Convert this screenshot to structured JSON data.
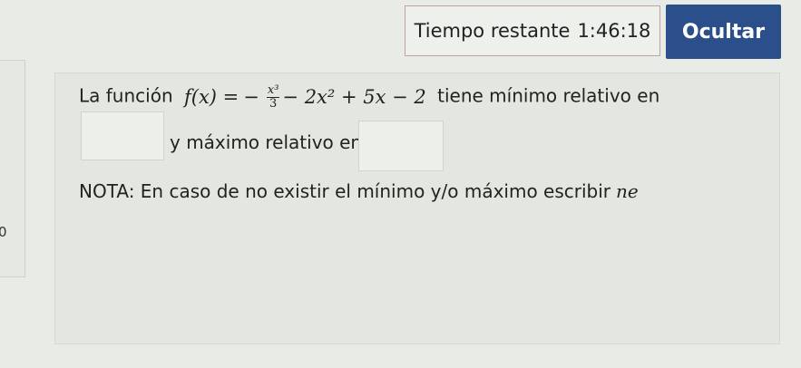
{
  "timer": {
    "label": "Tiempo restante",
    "value": "1:46:18"
  },
  "hide_button": {
    "label": "Ocultar"
  },
  "left_panel": {
    "value": "0"
  },
  "question": {
    "intro": "La función",
    "func_lhs": "f(x) =",
    "frac_num": "x³",
    "frac_den": "3",
    "func_rest": "− 2x² + 5x − 2",
    "after_func": "tiene mínimo relativo en",
    "max_text": "y máximo relativo en",
    "note": "NOTA: En caso de no existir el mínimo y/o máximo escribir",
    "note_italic": "ne"
  }
}
